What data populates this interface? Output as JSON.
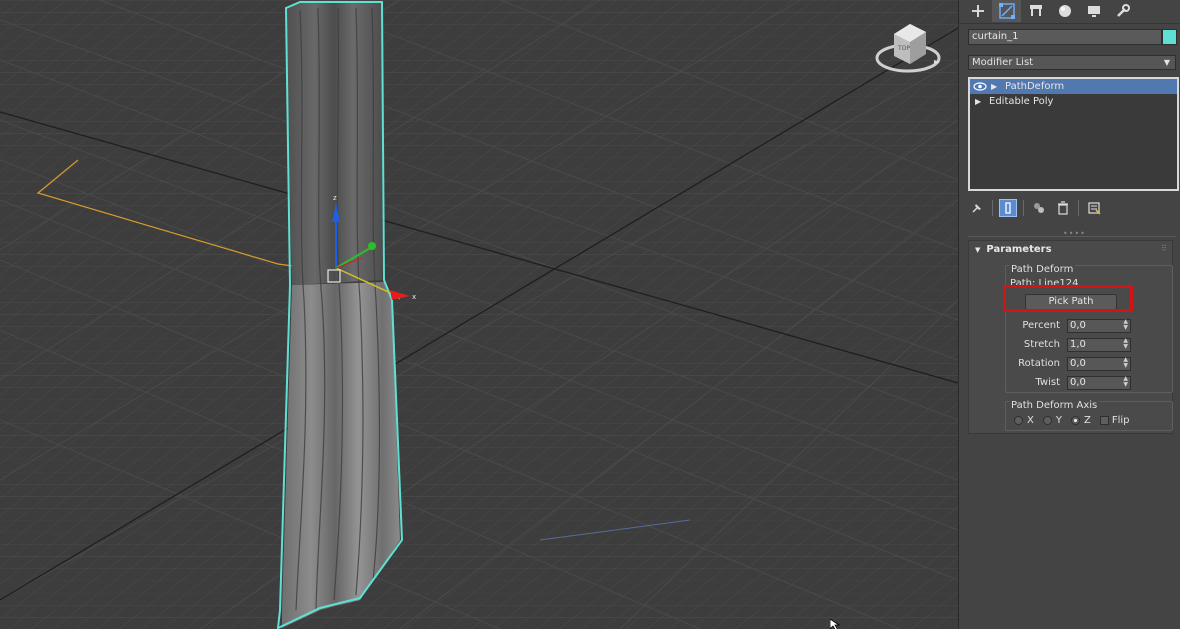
{
  "command_panel": {
    "tabs": [
      {
        "icon": "create-plus-icon"
      },
      {
        "icon": "modify-icon"
      },
      {
        "icon": "hierarchy-icon"
      },
      {
        "icon": "motion-icon"
      },
      {
        "icon": "display-icon"
      },
      {
        "icon": "utilities-wrench-icon"
      }
    ],
    "object_name": "curtain_1",
    "object_color": "#5fe0d2",
    "modifier_list_label": "Modifier List",
    "stack": [
      {
        "label": "PathDeform",
        "selected": true
      },
      {
        "label": "Editable Poly",
        "selected": false
      }
    ],
    "parameters": {
      "rollout_title": "Parameters",
      "group_title": "Path Deform",
      "path_label": "Path: Line124",
      "pick_path_label": "Pick Path",
      "fields": [
        {
          "label": "Percent",
          "value": "0,0"
        },
        {
          "label": "Stretch",
          "value": "1,0"
        },
        {
          "label": "Rotation",
          "value": "0,0"
        },
        {
          "label": "Twist",
          "value": "0,0"
        }
      ],
      "axis_group_title": "Path Deform Axis",
      "axis_options": [
        {
          "label": "X",
          "selected": false
        },
        {
          "label": "Y",
          "selected": false
        },
        {
          "label": "Z",
          "selected": true
        }
      ],
      "flip_label": "Flip"
    }
  },
  "viewport": {
    "gizmo_x_label": "x",
    "gizmo_z_label": "z",
    "viewcube_label": "TOP"
  },
  "colors": {
    "highlight": "#d21414",
    "selection_outline": "#5fe0d2",
    "accent_selected": "#5278b0"
  }
}
